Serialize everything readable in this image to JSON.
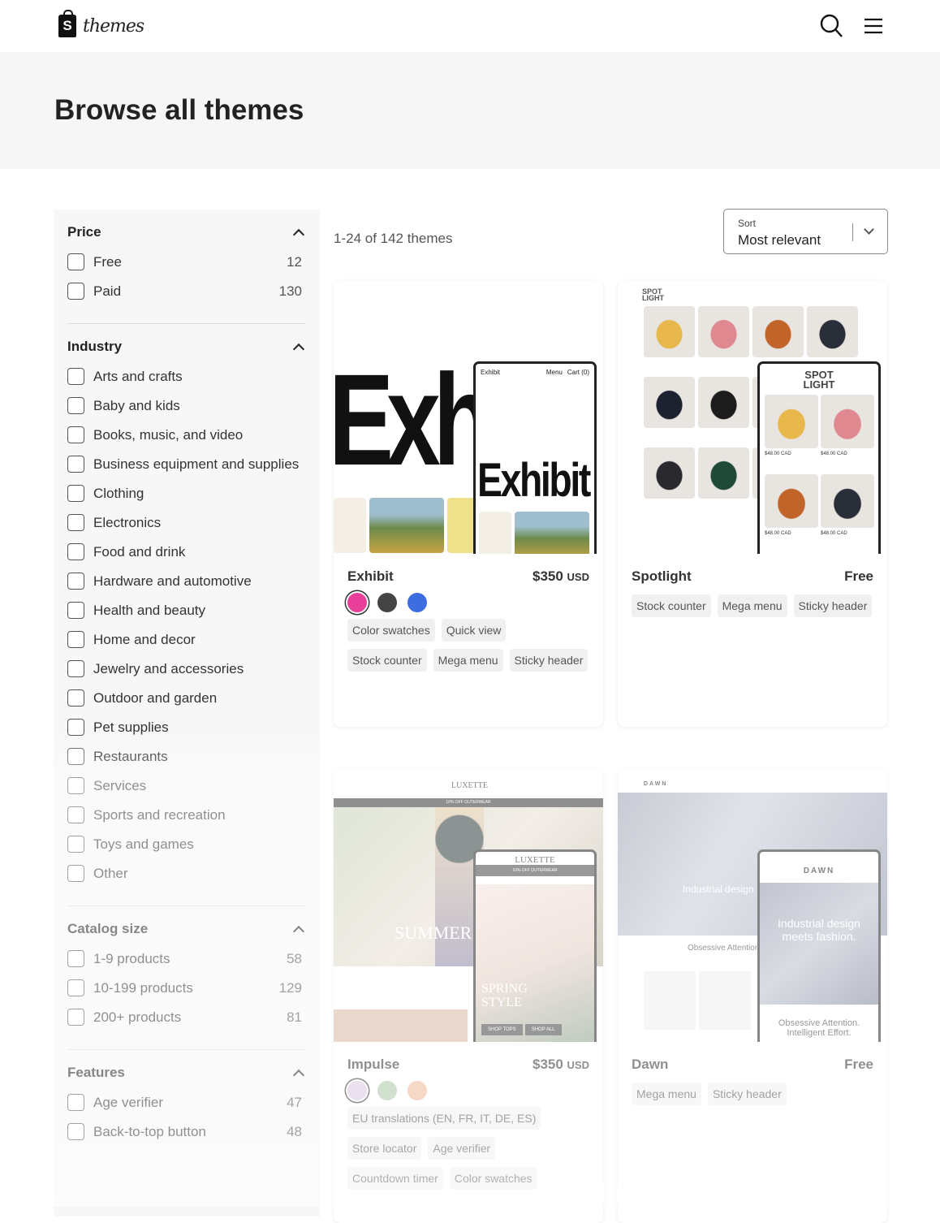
{
  "header": {
    "logo_text": "themes",
    "logo_letter": "S"
  },
  "page": {
    "title": "Browse all themes"
  },
  "filters": {
    "price": {
      "title": "Price",
      "options": [
        {
          "label": "Free",
          "count": "12"
        },
        {
          "label": "Paid",
          "count": "130"
        }
      ]
    },
    "industry": {
      "title": "Industry",
      "options": [
        "Arts and crafts",
        "Baby and kids",
        "Books, music, and video",
        "Business equipment and supplies",
        "Clothing",
        "Electronics",
        "Food and drink",
        "Hardware and automotive",
        "Health and beauty",
        "Home and decor",
        "Jewelry and accessories",
        "Outdoor and garden",
        "Pet supplies",
        "Restaurants",
        "Services",
        "Sports and recreation",
        "Toys and games",
        "Other"
      ]
    },
    "catalog": {
      "title": "Catalog size",
      "options": [
        {
          "label": "1-9 products",
          "count": "58"
        },
        {
          "label": "10-199 products",
          "count": "129"
        },
        {
          "label": "200+ products",
          "count": "81"
        }
      ]
    },
    "features": {
      "title": "Features",
      "options": [
        {
          "label": "Age verifier",
          "count": "47"
        },
        {
          "label": "Back-to-top button",
          "count": "48"
        }
      ]
    }
  },
  "results": {
    "count_text": "1-24 of 142 themes",
    "sort_label": "Sort",
    "sort_value": "Most relevant"
  },
  "themes": [
    {
      "name": "Exhibit",
      "price": "$350",
      "currency": "USD",
      "swatches": [
        "#e8409a",
        "#444444",
        "#3d6de0"
      ],
      "tags": [
        "Color swatches",
        "Quick view",
        "Stock counter",
        "Mega menu",
        "Sticky header"
      ],
      "preview": {
        "big": "Exh",
        "phone_title": "Exhibit",
        "menu": "Menu",
        "cart": "Cart (0)",
        "phone_big": "Exhibit"
      }
    },
    {
      "name": "Spotlight",
      "price": "Free",
      "tags": [
        "Stock counter",
        "Mega menu",
        "Sticky header"
      ],
      "preview": {
        "logo": "SPOT LIGHT",
        "price": "$48.00 CAD"
      }
    },
    {
      "name": "Impulse",
      "price": "$350",
      "currency": "USD",
      "swatches": [
        "#d9c8e0",
        "#a9c8a4",
        "#efb898"
      ],
      "tags": [
        "EU translations (EN, FR, IT, DE, ES)",
        "Store locator",
        "Age verifier",
        "Countdown timer",
        "Color swatches"
      ],
      "preview": {
        "logo": "LUXETTE",
        "banner": "10% OFF OUTERWEAR",
        "hero": "SUMMER",
        "phone_hero": "SPRING STYLE",
        "btn1": "SHOP TOPS",
        "btn2": "SHOP ALL"
      }
    },
    {
      "name": "Dawn",
      "price": "Free",
      "tags": [
        "Mega menu",
        "Sticky header"
      ],
      "preview": {
        "logo": "DAWN",
        "hero": "Industrial design",
        "phone_hero": "Industrial design meets fashion.",
        "sub": "Obsessive Attention.",
        "phone_sub": "Obsessive Attention. Intelligent Effort."
      }
    }
  ]
}
